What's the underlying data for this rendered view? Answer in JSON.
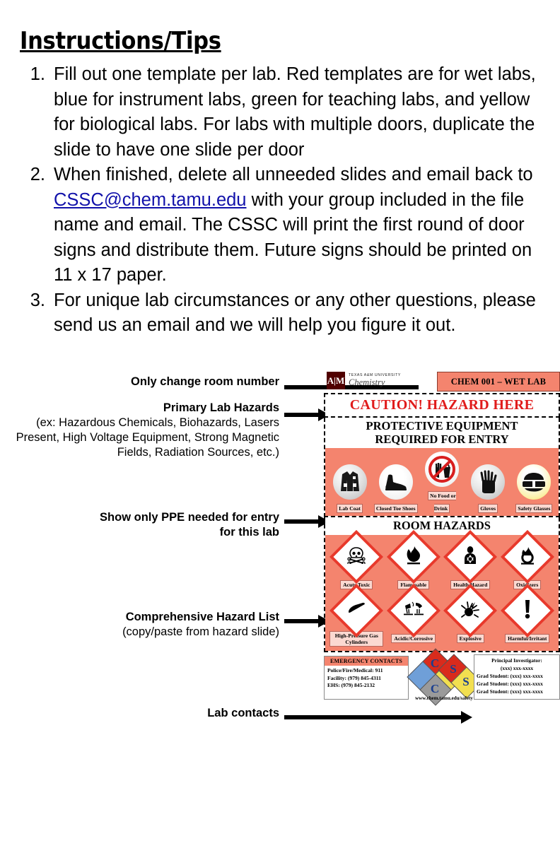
{
  "page": {
    "title": "Instructions/Tips"
  },
  "instructions": [
    {
      "number": "1.",
      "text": "Fill out one template per lab.  Red templates are for wet labs, blue for instrument labs, green for teaching labs, and yellow for biological labs. For labs with multiple doors, duplicate the slide to have one slide per door"
    },
    {
      "number": "2.",
      "pre": "When finished, delete all unneeded slides and email back to ",
      "link": "CSSC@chem.tamu.edu",
      "post": " with your group included in the file name and email.  The CSSC will print the first round of door signs and distribute them.  Future signs should be printed on 11 x 17 paper."
    },
    {
      "number": "3.",
      "text": "For unique lab circumstances or any other questions, please send us an email and we will help you figure it out."
    }
  ],
  "callouts": {
    "room_number": "Only change room number",
    "primary_hazards_title": "Primary Lab Hazards",
    "primary_hazards_sub": "(ex: Hazardous Chemicals, Biohazards, Lasers Present, High Voltage Equipment, Strong Magnetic Fields, Radiation Sources, etc.)",
    "ppe_line1": "Show only PPE needed for entry",
    "ppe_line2": "for this lab",
    "hazard_list_title": "Comprehensive Hazard List",
    "hazard_list_sub": "(copy/paste from hazard slide)",
    "lab_contacts": "Lab contacts"
  },
  "sign": {
    "logo": {
      "mark": "A|M",
      "line1": "TEXAS A&M UNIVERSITY",
      "line2": "Chemistry"
    },
    "room_title": "CHEM 001 – WET LAB",
    "caution": "CAUTION! HAZARD HERE",
    "ppe_heading_line1": "PROTECTIVE EQUIPMENT",
    "ppe_heading_line2": "REQUIRED FOR ENTRY",
    "ppe": [
      {
        "icon": "lab-coat-icon",
        "glyph": "🥼",
        "label": "Lab Coat",
        "badge": "b-grey"
      },
      {
        "icon": "closed-toe-shoes-icon",
        "glyph": "🥾",
        "label": "Closed Toe Shoes",
        "badge": "b-white"
      },
      {
        "icon": "no-food-or-drink-icon",
        "glyph": "🚫",
        "label": "No Food or Drink",
        "badge": "b-white"
      },
      {
        "icon": "gloves-icon",
        "glyph": "🧤",
        "label": "Gloves",
        "badge": "b-grey"
      },
      {
        "icon": "safety-glasses-icon",
        "glyph": "🥽",
        "label": "Safety Glasses",
        "badge": "b-yellow"
      }
    ],
    "hazards_heading": "ROOM HAZARDS",
    "hazards": [
      {
        "icon": "skull-crossbones-icon",
        "glyph": "☠",
        "label": "Acute Toxic"
      },
      {
        "icon": "flame-icon",
        "glyph": "🔥",
        "label": "Flammable"
      },
      {
        "icon": "health-hazard-icon",
        "glyph": "☣",
        "label": "Health Hazard"
      },
      {
        "icon": "oxidizer-icon",
        "glyph": "◎",
        "label": "Oxidizers"
      },
      {
        "icon": "gas-cylinder-icon",
        "glyph": "⬭",
        "label": "High-Pressure Gas Cylinders"
      },
      {
        "icon": "corrosion-icon",
        "glyph": "⚗",
        "label": "Acidic/Corrosive"
      },
      {
        "icon": "exploding-bomb-icon",
        "glyph": "✸",
        "label": "Explosive"
      },
      {
        "icon": "exclamation-icon",
        "glyph": "!",
        "label": "Harmful/Irritant"
      }
    ],
    "emergency": {
      "heading": "EMERGENCY CONTACTS",
      "lines": [
        "Police/Fire/Medical: 911",
        "Facility: (979) 845-4311",
        "EHS: (979) 845-2132"
      ]
    },
    "cssc": {
      "letters": [
        "C",
        "S",
        "S",
        "C"
      ],
      "url": "www.chem.tamu.edu/safety"
    },
    "pi": {
      "title": "Principal Investigator:",
      "phone": "(xxx) xxx-xxxx",
      "students": [
        "Grad Student:  (xxx) xxx-xxxx",
        "Grad Student:  (xxx) xxx-xxxx",
        "Grad Student:  (xxx) xxx-xxxx"
      ]
    }
  },
  "colors": {
    "salmon": "#F4846E",
    "caution_red": "#e01b1b",
    "diamond_red": "#e8392b",
    "maroon": "#500000",
    "link_blue": "#1111aa"
  }
}
